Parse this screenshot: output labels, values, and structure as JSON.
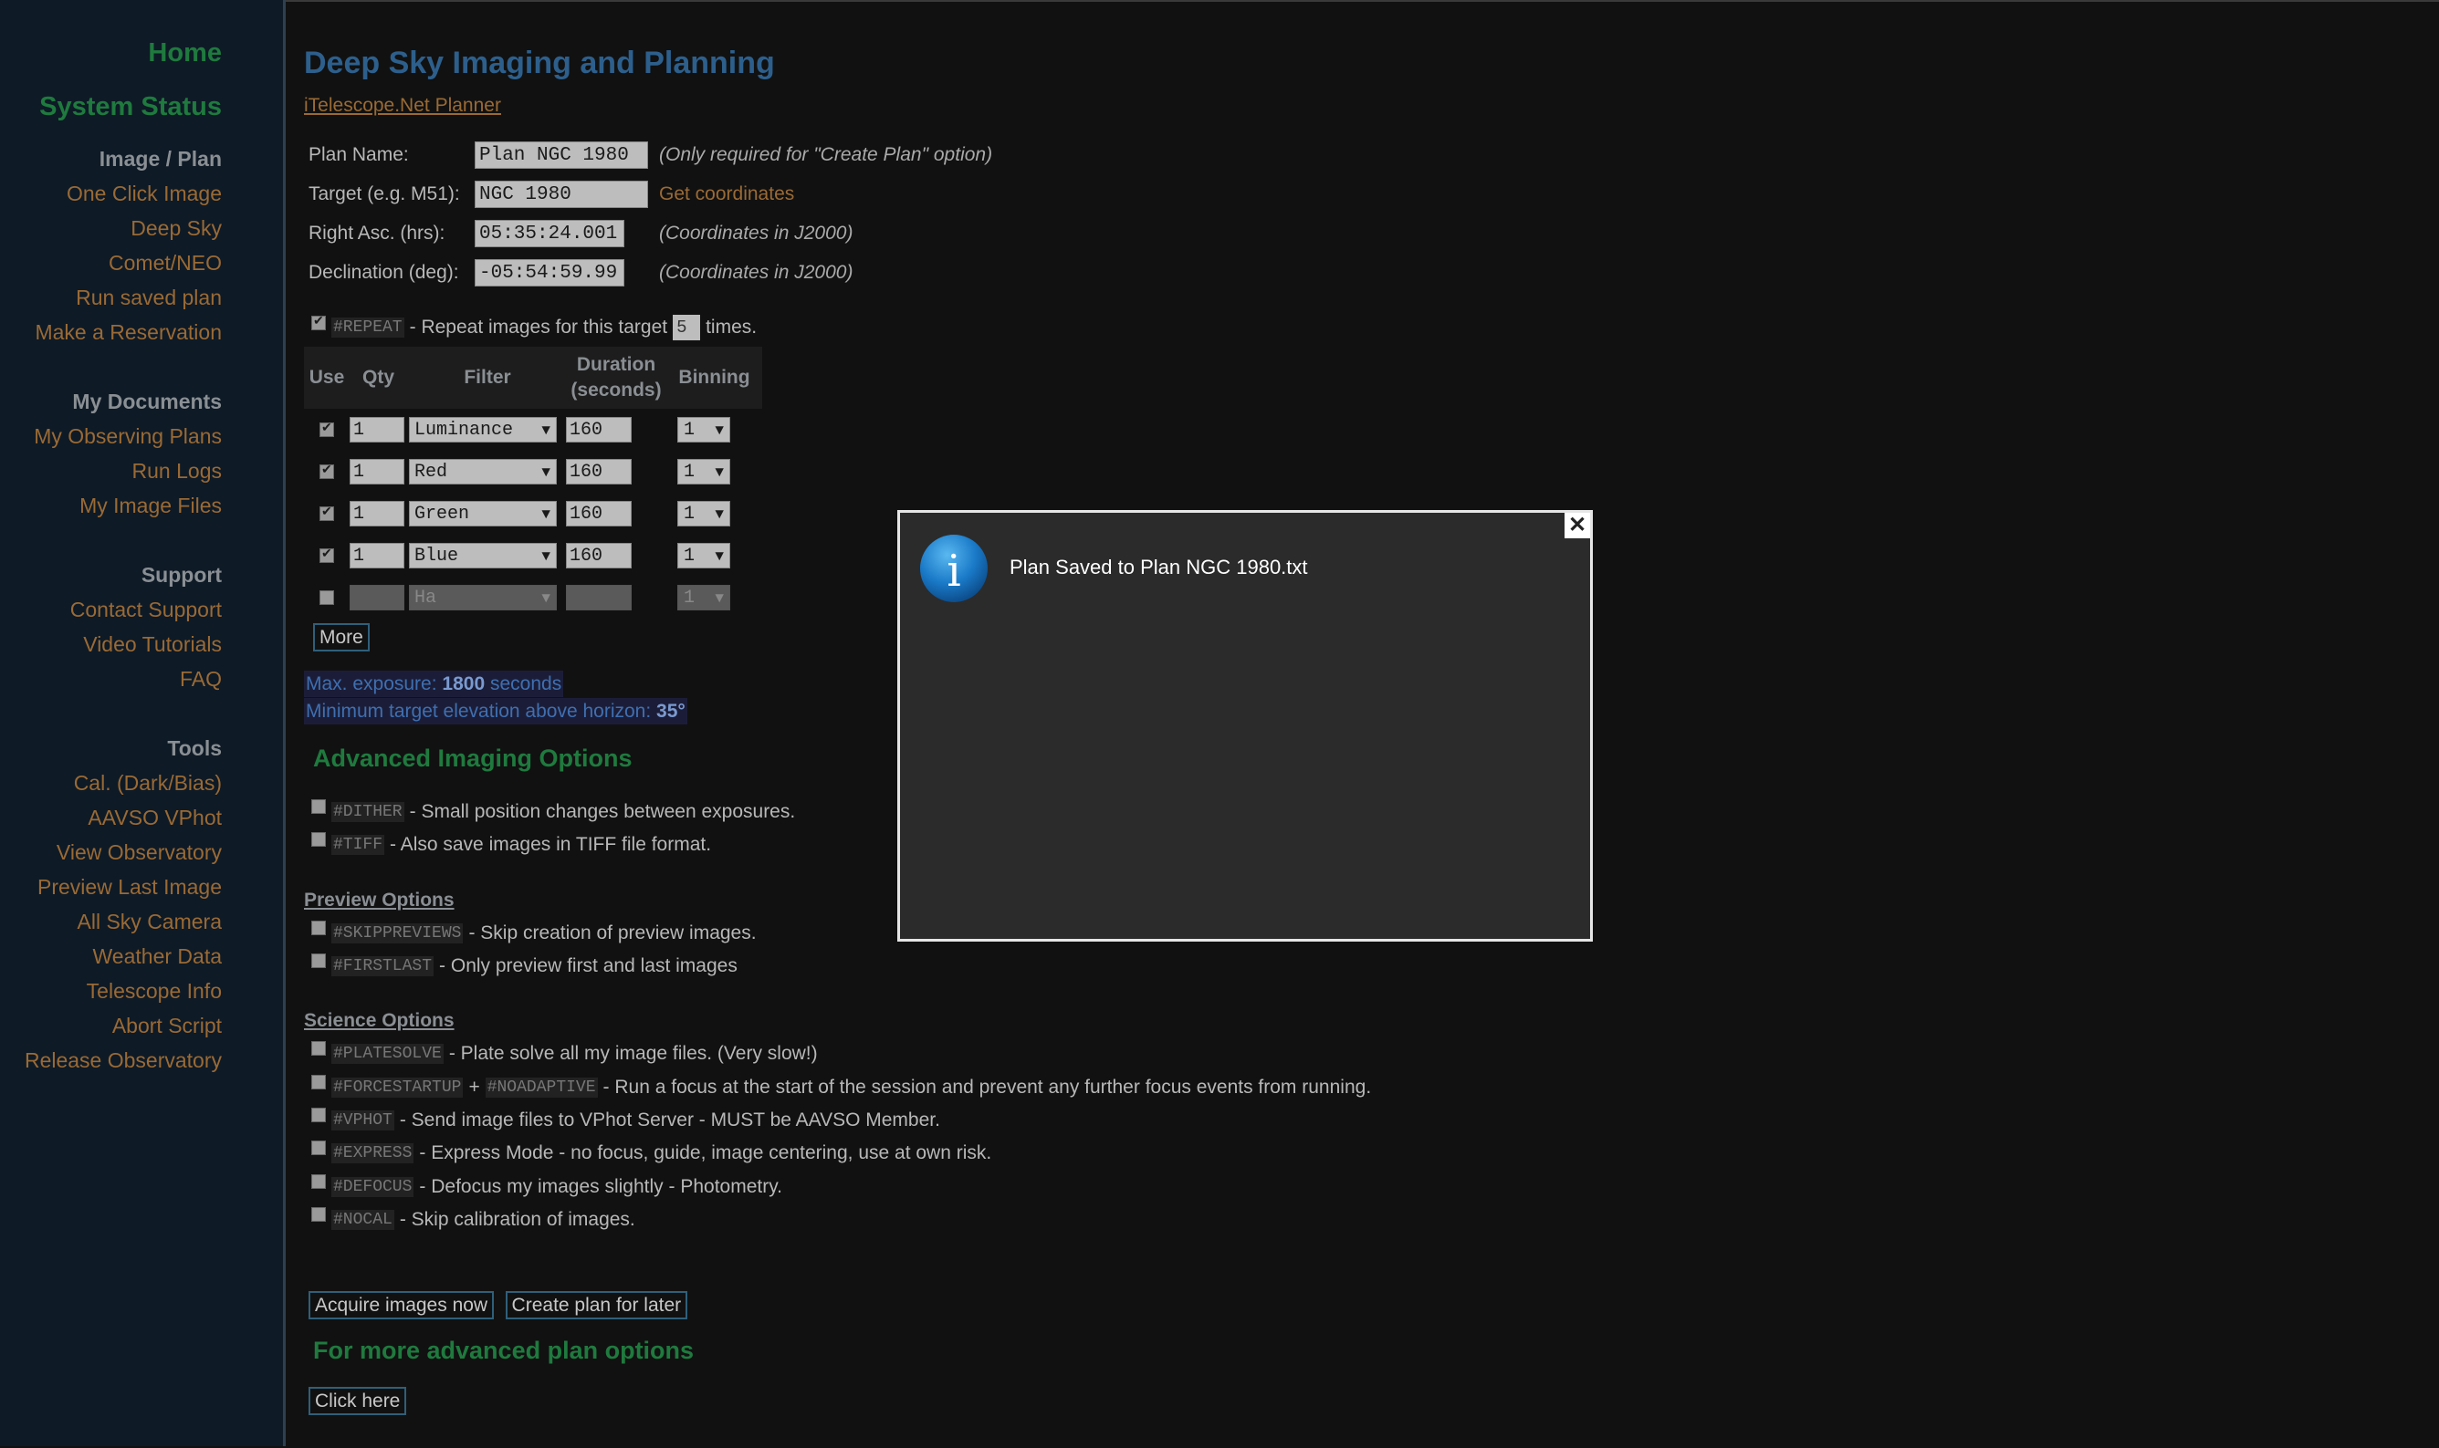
{
  "sidebar": {
    "home": "Home",
    "system_status": "System Status",
    "groups": [
      {
        "head": "Image / Plan",
        "items": [
          "One Click Image",
          "Deep Sky",
          "Comet/NEO",
          "Run saved plan",
          "Make a Reservation"
        ]
      },
      {
        "head": "My Documents",
        "items": [
          "My Observing Plans",
          "Run Logs",
          "My Image Files"
        ]
      },
      {
        "head": "Support",
        "items": [
          "Contact Support",
          "Video Tutorials",
          "FAQ"
        ]
      },
      {
        "head": "Tools",
        "items": [
          "Cal. (Dark/Bias)",
          "AAVSO VPhot",
          "View Observatory",
          "Preview Last Image",
          "All Sky Camera",
          "Weather Data",
          "Telescope Info",
          "Abort Script",
          "Release Observatory"
        ]
      }
    ]
  },
  "main": {
    "title": "Deep Sky Imaging and Planning",
    "planner_link": "iTelescope.Net Planner",
    "plan_name": {
      "label": "Plan Name:",
      "value": "Plan NGC 1980",
      "hint": "(Only required for \"Create Plan\" option)"
    },
    "target": {
      "label": "Target (e.g. M51):",
      "value": "NGC 1980",
      "link": "Get coordinates"
    },
    "ra": {
      "label": "Right Asc. (hrs):",
      "value": "05:35:24.001",
      "hint": "(Coordinates in J2000)"
    },
    "dec": {
      "label": "Declination (deg):",
      "value": "-05:54:59.99",
      "hint": "(Coordinates in J2000)"
    },
    "repeat": {
      "code": "#REPEAT",
      "text_before": "- Repeat images for this target",
      "value": "5",
      "text_after": "times."
    },
    "table": {
      "headers": {
        "use": "Use",
        "qty": "Qty",
        "filter": "Filter",
        "duration": "Duration (seconds)",
        "binning": "Binning"
      },
      "rows": [
        {
          "qty": "1",
          "filter": "Luminance",
          "duration": "160",
          "binning": "1"
        },
        {
          "qty": "1",
          "filter": "Red",
          "duration": "160",
          "binning": "1"
        },
        {
          "qty": "1",
          "filter": "Green",
          "duration": "160",
          "binning": "1"
        },
        {
          "qty": "1",
          "filter": "Blue",
          "duration": "160",
          "binning": "1"
        },
        {
          "qty": "",
          "filter": "Ha",
          "duration": "",
          "binning": "1"
        }
      ]
    },
    "more_button": "More",
    "max_exposure": {
      "before": "Max. exposure:",
      "value": "1800",
      "after": "seconds"
    },
    "min_elevation": {
      "before": "Minimum target elevation above horizon:",
      "value": "35°"
    },
    "advanced_title": "Advanced Imaging Options",
    "advanced": [
      {
        "code": "#DITHER",
        "text": "- Small position changes between exposures."
      },
      {
        "code": "#TIFF",
        "text": "- Also save images in TIFF file format."
      }
    ],
    "preview_title": "Preview Options",
    "preview": [
      {
        "code": "#SKIPPREVIEWS",
        "text": "- Skip creation of preview images."
      },
      {
        "code": "#FIRSTLAST",
        "text": "- Only preview first and last images"
      }
    ],
    "science_title": "Science Options",
    "science": [
      {
        "code": "#PLATESOLVE",
        "text": "- Plate solve all my image files. (Very slow!)"
      },
      {
        "code": "#FORCESTARTUP",
        "plus": "+",
        "code2": "#NOADAPTIVE",
        "text": "- Run a focus at the start of the session and prevent any further focus events from running."
      },
      {
        "code": "#VPHOT",
        "text": "- Send image files to VPhot Server - MUST be AAVSO Member."
      },
      {
        "code": "#EXPRESS",
        "text": "- Express Mode - no focus, guide, image centering, use at own risk."
      },
      {
        "code": "#DEFOCUS",
        "text": "- Defocus my images slightly - Photometry."
      },
      {
        "code": "#NOCAL",
        "text": "- Skip calibration of images."
      }
    ],
    "acquire_button": "Acquire images now",
    "create_plan_button": "Create plan for later",
    "more_options_title": "For more advanced plan options",
    "click_here_button": "Click here"
  },
  "modal": {
    "message": "Plan Saved to Plan NGC 1980.txt",
    "close": "✕",
    "icon": "info-icon",
    "icon_letter": "i"
  },
  "colors": {
    "accent_green": "#1f7a3e",
    "title_blue": "#2d5f8c",
    "link_orange": "#9a6a35"
  }
}
